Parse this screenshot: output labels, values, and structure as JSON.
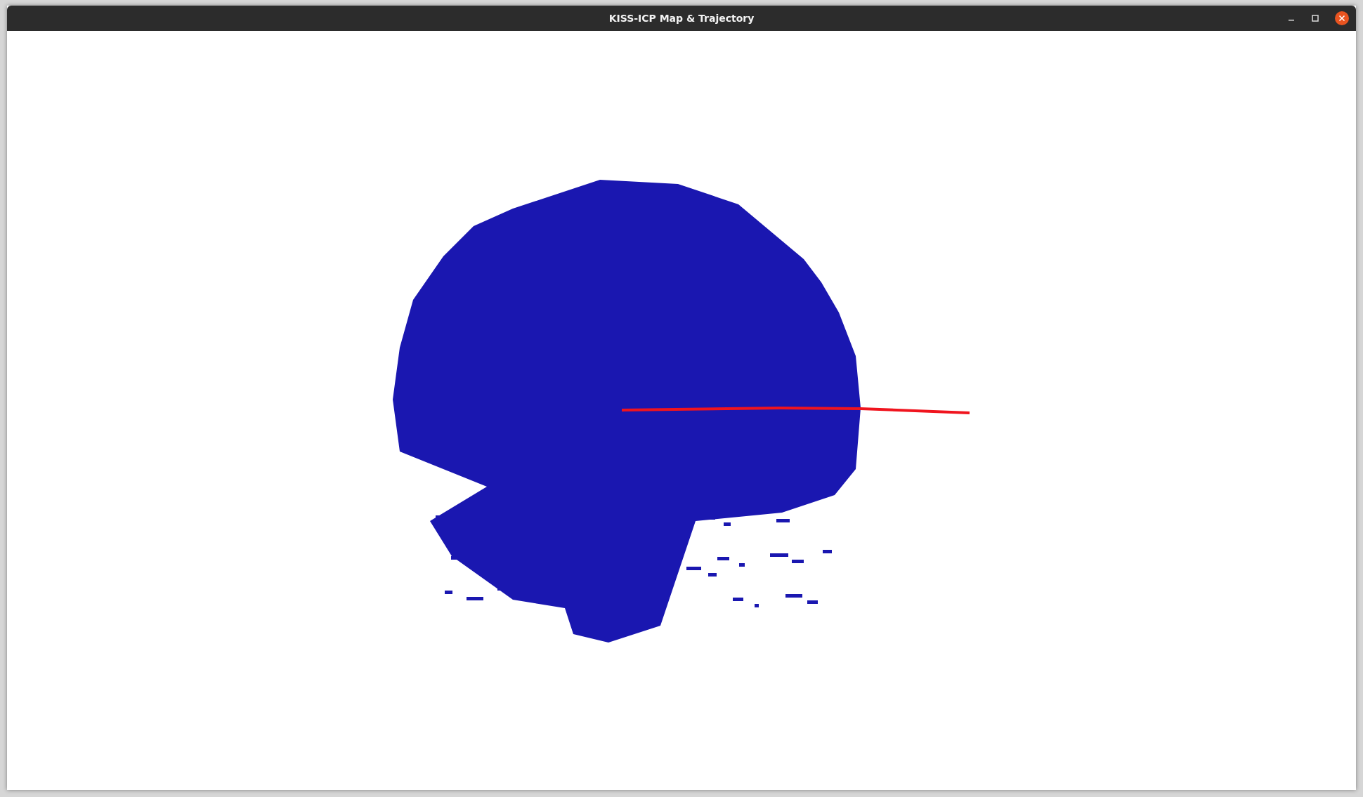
{
  "window": {
    "title": "KISS-ICP Map & Trajectory"
  }
}
